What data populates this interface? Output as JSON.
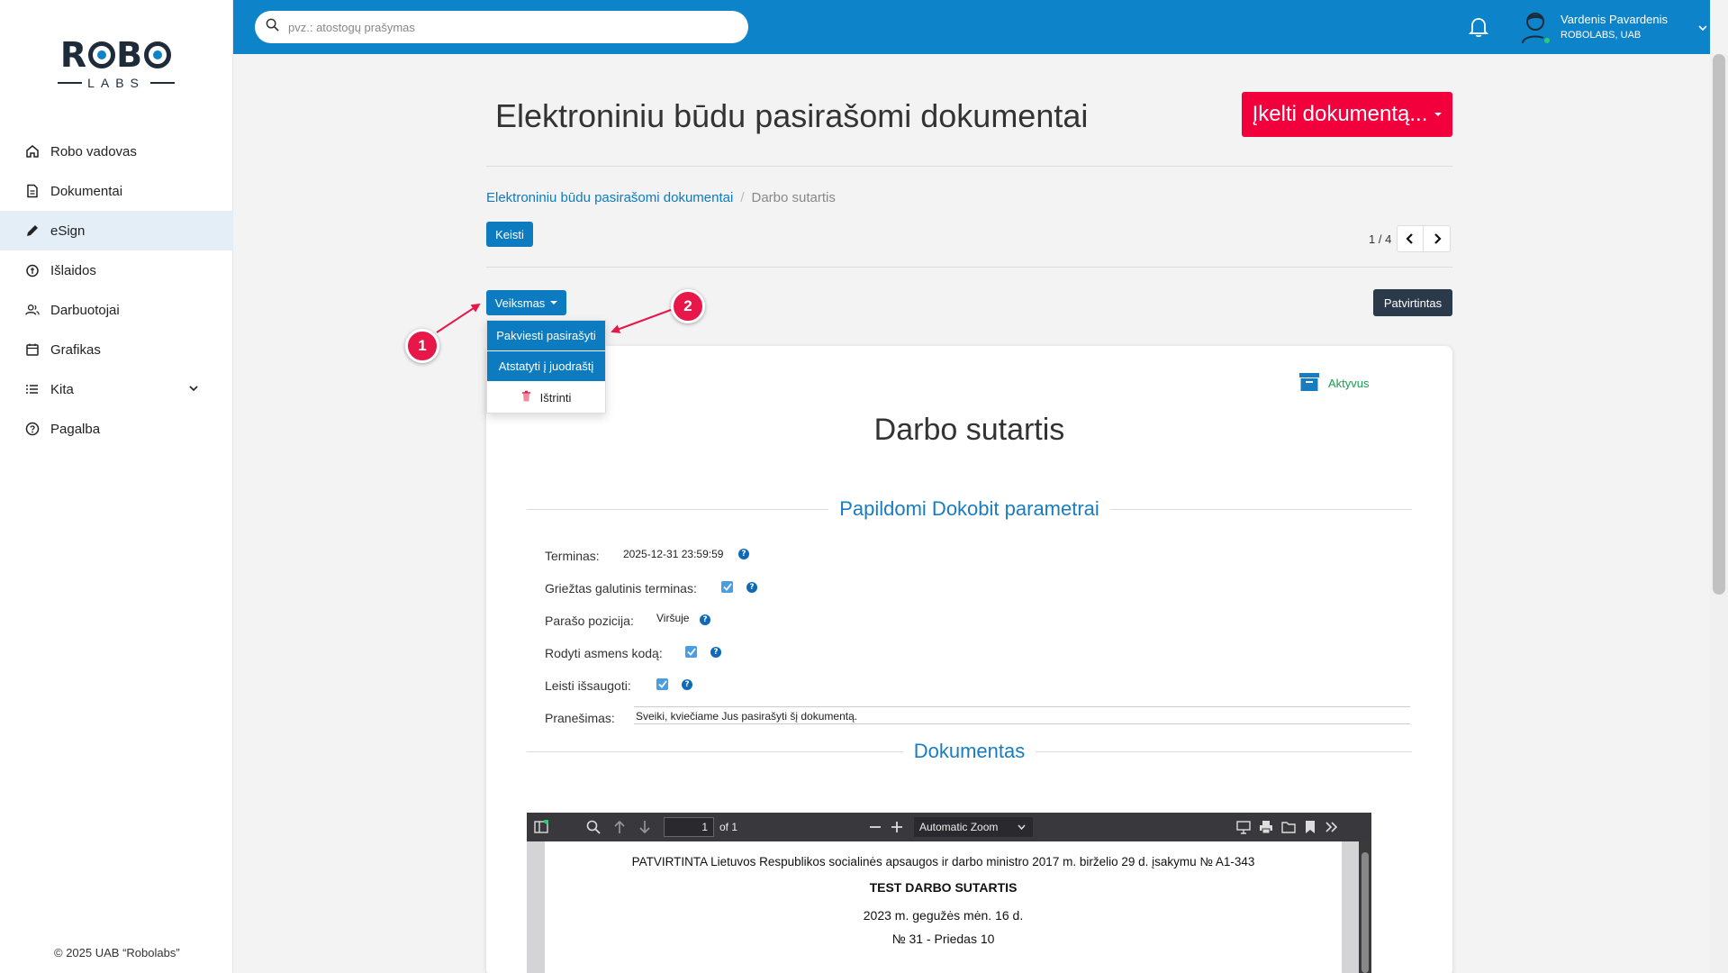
{
  "sidebar": {
    "logo_top": "ROBO",
    "logo_bottom": "LABS",
    "items": [
      {
        "label": "Robo vadovas",
        "icon": "home-icon"
      },
      {
        "label": "Dokumentai",
        "icon": "document-icon"
      },
      {
        "label": "eSign",
        "icon": "pen-icon",
        "active": true
      },
      {
        "label": "Išlaidos",
        "icon": "expenses-icon"
      },
      {
        "label": "Darbuotojai",
        "icon": "users-icon"
      },
      {
        "label": "Grafikas",
        "icon": "calendar-icon"
      },
      {
        "label": "Kita",
        "icon": "list-icon"
      },
      {
        "label": "Pagalba",
        "icon": "help-circle-icon"
      }
    ],
    "copyright": "© 2025 UAB “Robolabs”"
  },
  "topbar": {
    "search_placeholder": "pvz.: atostogų prašymas",
    "user_name": "Vardenis Pavardenis",
    "user_company": "ROBOLABS, UAB"
  },
  "page": {
    "title": "Elektroniniu būdu pasirašomi dokumentai",
    "upload_label": "Įkelti dokumentą...",
    "breadcrumb": [
      "Elektroniniu būdu pasirašomi dokumentai",
      "Darbo sutartis"
    ],
    "edit_label": "Keisti",
    "pager": "1 / 4",
    "action_label": "Veiksmas",
    "confirmed_label": "Patvirtintas",
    "dropdown": [
      "Pakviesti pasirašyti",
      "Atstatyti į juodraštį",
      "Ištrinti"
    ]
  },
  "document": {
    "status": "Aktyvus",
    "title": "Darbo sutartis",
    "section_params": "Papildomi Dokobit parametrai",
    "fields": {
      "deadline_label": "Terminas:",
      "deadline_value": "2025-12-31 23:59:59",
      "strict_label": "Griežtas galutinis terminas:",
      "position_label": "Parašo pozicija:",
      "position_value": "Viršuje",
      "show_code_label": "Rodyti asmens kodą:",
      "allow_save_label": "Leisti išsaugoti:",
      "message_label": "Pranešimas:",
      "message_value": "Sveiki, kviečiame Jus pasirašyti šį dokumentą."
    },
    "section_document": "Dokumentas"
  },
  "pdf": {
    "page_value": "1",
    "page_of": "of 1",
    "zoom": "Automatic Zoom",
    "lines": [
      "PATVIRTINTA Lietuvos Respublikos socialinės apsaugos ir darbo ministro 2017 m. birželio 29 d. įsakymu № A1-343",
      "TEST DARBO SUTARTIS",
      "2023 m. gegužės mėn. 16 d.",
      "№ 31 - Priedas 10"
    ]
  },
  "annotations": [
    "1",
    "2"
  ],
  "colors": {
    "primary": "#0d84c9",
    "danger": "#f2003c",
    "dark": "#2b3a4a",
    "success": "#1a9e4e",
    "annotation": "#e8174a"
  }
}
